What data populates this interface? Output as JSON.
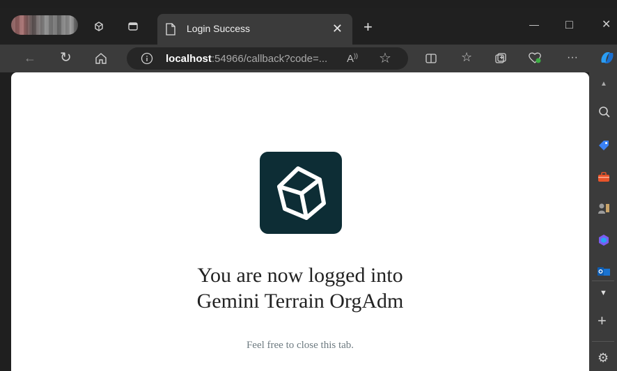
{
  "browser": {
    "tab": {
      "title": "Login Success"
    },
    "address_bar": {
      "host": "localhost",
      "rest": ":54966/callback?code=..."
    },
    "window_controls": {
      "minimize": "—",
      "maximize": "□",
      "close": "✕"
    },
    "toolbar": {
      "more_label": "···"
    }
  },
  "page": {
    "headline_line1": "You are now logged into",
    "headline_line2": "Gemini Terrain OrgAdm",
    "subtext": "Feel free to close this tab."
  },
  "colors": {
    "logo_bg": "#0d2d35",
    "browser_bg": "#1f1f1f",
    "toolbar_bg": "#3b3b3b"
  }
}
